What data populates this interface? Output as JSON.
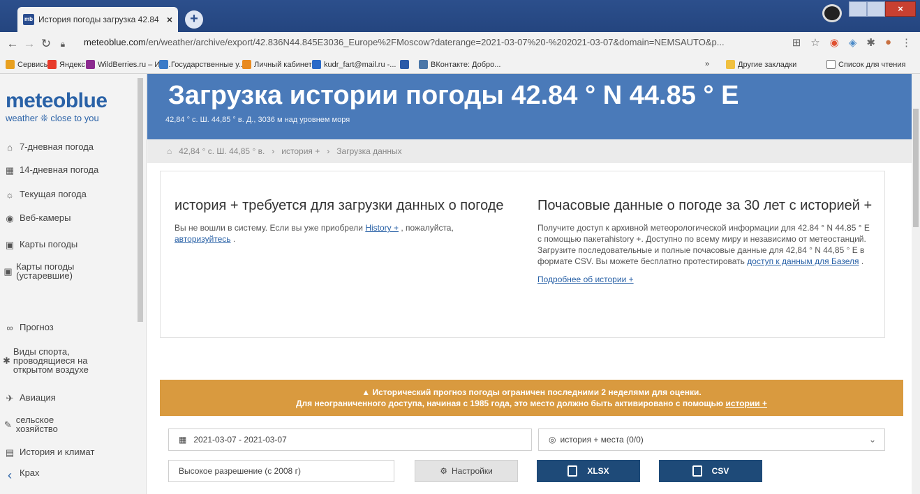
{
  "browser": {
    "tab_title": "История погоды загрузка 42.84",
    "tab_favicon": "mb",
    "url_host": "meteoblue.com",
    "url_path": "/en/weather/archive/export/42.836N44.845E3036_Europe%2FMoscow?daterange=2021-03-07%20-%202021-03-07&domain=NEMSAUTO&p..."
  },
  "bookmarks": [
    {
      "label": "Сервисы",
      "color": "#e8a020"
    },
    {
      "label": "Яндекс",
      "color": "#e83a2a"
    },
    {
      "label": "WildBerries.ru – Ин...",
      "color": "#8b2a8f"
    },
    {
      "label": "Государственные у...",
      "color": "#3a7ac8"
    },
    {
      "label": "Личный кабинет",
      "color": "#e88a20"
    },
    {
      "label": "kudr_fart@mail.ru -...",
      "color": "#2a6ac8"
    },
    {
      "label": "ВКонтакте: Добро...",
      "color": "#4a76a8"
    }
  ],
  "bookmarks_right": {
    "more": "»",
    "other": "Другие закладки",
    "reading": "Список для чтения"
  },
  "sidebar": {
    "brand": "meteoblue",
    "tagline": "weather ❊ close to you",
    "items": [
      {
        "icon": "⌂",
        "label": "7-дневная погода"
      },
      {
        "icon": "▦",
        "label": "14-дневная погода"
      },
      {
        "icon": "☼",
        "label": "Текущая погода"
      },
      {
        "icon": "◉",
        "label": "Веб-камеры"
      },
      {
        "icon": "▣",
        "label": "Карты погоды"
      },
      {
        "icon": "▣",
        "label": "Карты погоды (устаревшие)"
      },
      {
        "icon": "∞",
        "label": "Прогноз"
      },
      {
        "icon": "✱",
        "label": "Виды спорта, проводящиеся на открытом воздухе"
      },
      {
        "icon": "✈",
        "label": "Авиация"
      },
      {
        "icon": "✎",
        "label": "сельское хозяйство"
      },
      {
        "icon": "▤",
        "label": "История и климат"
      },
      {
        "icon": "‹",
        "label": "Крах"
      }
    ]
  },
  "hero": {
    "title": "Загрузка истории погоды 42.84 ° N 44.85 ° E",
    "subtitle": "42,84 ° с. Ш. 44,85 ° в. Д., 3036 м над уровнем моря"
  },
  "breadcrumb": [
    "42,84 ° с. Ш. 44,85 ° в.",
    "история +",
    "Загрузка данных"
  ],
  "left_col": {
    "heading": "история + требуется для загрузки данных о погоде",
    "text1": "Вы не вошли в систему. Если вы уже приобрели ",
    "link1": "History +",
    "text2": " , пожалуйста, ",
    "link2": "авторизуйтесь",
    "text3": " ."
  },
  "right_col": {
    "heading": "Почасовые данные о погоде за 30 лет с историей +",
    "text1": "Получите доступ к архивной метеорологической информации для 42.84 ° N 44.85 ° E с помощью пакетаhistory +. Доступно по всему миру и независимо от метеостанций. Загрузите последовательные и полные почасовые данные для 42,84 ° N 44,85 ° E в формате CSV. Вы можете бесплатно протестировать ",
    "link1": "доступ к данным для Базеля",
    "text2": " .",
    "more_link": "Подробнее об истории +"
  },
  "warning": {
    "line1": "▲ Исторический прогноз погоды ограничен последними 2 неделями для оценки.",
    "line2": "Для неограниченного доступа, начиная с 1985 года, это место должно быть активировано с помощью ",
    "link": "истории +"
  },
  "controls": {
    "daterange": "2021-03-07 - 2021-03-07",
    "location": "история + места (0/0)",
    "resolution": "Высокое разрешение (с 2008 г)",
    "settings": "Настройки",
    "xlsx": "XLSX",
    "csv": "CSV"
  }
}
